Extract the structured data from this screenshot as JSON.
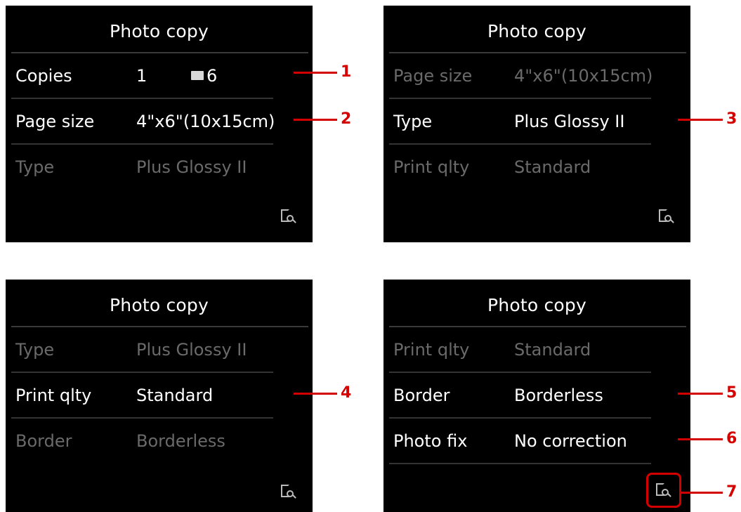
{
  "panels": [
    {
      "title": "Photo copy",
      "rows": [
        {
          "label": "Copies",
          "value": "1",
          "sheets": "6"
        },
        {
          "label": "Page size",
          "value": "4\"x6\"(10x15cm)"
        },
        {
          "label": "Type",
          "value": "Plus Glossy II"
        }
      ]
    },
    {
      "title": "Photo copy",
      "rows": [
        {
          "label": "Page size",
          "value": "4\"x6\"(10x15cm)"
        },
        {
          "label": "Type",
          "value": "Plus Glossy II"
        },
        {
          "label": "Print qlty",
          "value": "Standard"
        }
      ]
    },
    {
      "title": "Photo copy",
      "rows": [
        {
          "label": "Type",
          "value": "Plus Glossy II"
        },
        {
          "label": "Print qlty",
          "value": "Standard"
        },
        {
          "label": "Border",
          "value": "Borderless"
        }
      ]
    },
    {
      "title": "Photo copy",
      "rows": [
        {
          "label": "Print qlty",
          "value": "Standard"
        },
        {
          "label": "Border",
          "value": "Borderless"
        },
        {
          "label": "Photo fix",
          "value": "No correction"
        }
      ]
    }
  ],
  "callouts": [
    "1",
    "2",
    "3",
    "4",
    "5",
    "6",
    "7"
  ],
  "icons": {
    "preview": "preview-icon",
    "sheets": "sheet-icon"
  },
  "colors": {
    "callout": "#d40000",
    "screen_bg": "#000000",
    "dim_text": "#6a6a6a"
  }
}
